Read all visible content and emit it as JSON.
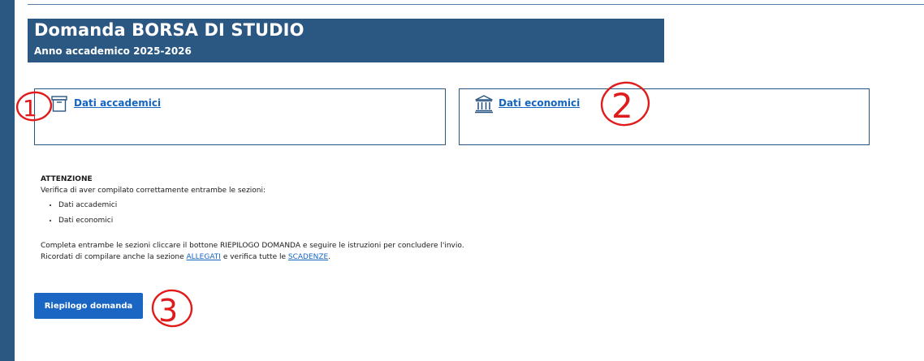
{
  "header": {
    "title": "Domanda BORSA DI STUDIO",
    "subtitle": "Anno accademico 2025-2026"
  },
  "cards": {
    "academic": {
      "label": "Dati accademici",
      "icon": "archive-box-icon"
    },
    "economic": {
      "label": "Dati economici",
      "icon": "bank-icon"
    }
  },
  "notice": {
    "heading": "ATTENZIONE",
    "intro": "Verifica di aver compilato correttamente entrambe le sezioni:",
    "items": [
      "Dati accademici",
      "Dati economici"
    ],
    "para1": "Completa entrambe le sezioni cliccare il bottone RIEPILOGO DOMANDA e seguire le istruzioni per concludere l'invio.",
    "para2_prefix": "Ricordati di compilare anche la sezione ",
    "allegati_link": "ALLEGATI",
    "para2_middle": " e verifica tutte le ",
    "scadenze_link": "SCADENZE",
    "para2_suffix": "."
  },
  "buttons": {
    "summary_label": "Riepilogo domanda"
  },
  "annotations": {
    "color": "#e01b1b",
    "numbers": [
      "1",
      "2",
      "3"
    ]
  },
  "colors": {
    "brand_blue": "#2b5783",
    "link_blue": "#1565c0",
    "button_blue": "#1a66c2"
  }
}
